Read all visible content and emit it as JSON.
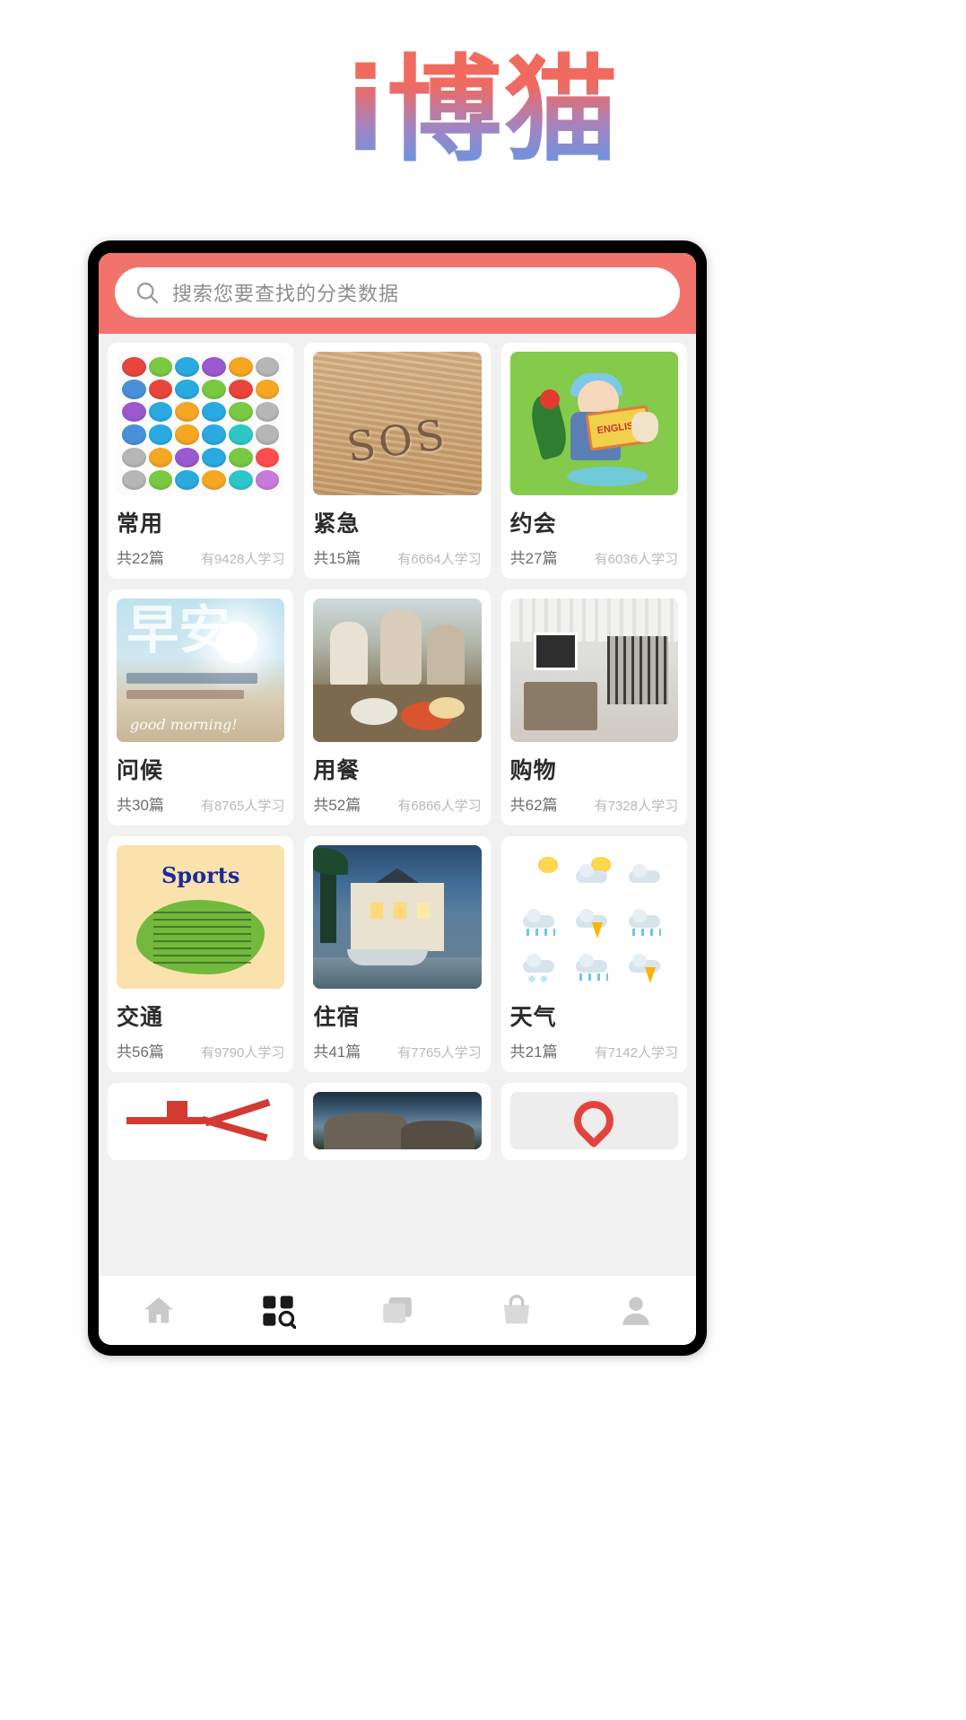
{
  "brand": {
    "title": "i博猫",
    "gradient_top": "#f26a5d",
    "gradient_bottom": "#6f93dd"
  },
  "phone": {
    "frame_color": "#000000",
    "screen_bg": "#f1f1f1"
  },
  "search": {
    "placeholder": "搜索您要查找的分类数据",
    "icon": "search-icon",
    "header_color": "#f2736c"
  },
  "categories": [
    {
      "title": "常用",
      "count": "共22篇",
      "learners": "有9428人学习",
      "art": "icon-grid"
    },
    {
      "title": "紧急",
      "count": "共15篇",
      "learners": "有6664人学习",
      "art": "desert-sos"
    },
    {
      "title": "约会",
      "count": "共27篇",
      "learners": "有6036人学习",
      "art": "green-english-girl"
    },
    {
      "title": "问候",
      "count": "共30篇",
      "learners": "有8765人学习",
      "art": "good-morning-sky"
    },
    {
      "title": "用餐",
      "count": "共52篇",
      "learners": "有6866人学习",
      "art": "dining-table"
    },
    {
      "title": "购物",
      "count": "共62篇",
      "learners": "有7328人学习",
      "art": "shop-interior"
    },
    {
      "title": "交通",
      "count": "共56篇",
      "learners": "有9790人学习",
      "art": "sports-poster"
    },
    {
      "title": "住宿",
      "count": "共41篇",
      "learners": "有7765人学习",
      "art": "hotel-night"
    },
    {
      "title": "天气",
      "count": "共21篇",
      "learners": "有7142人学习",
      "art": "weather-icons"
    },
    {
      "title": "",
      "count": "",
      "learners": "",
      "art": "red-arrows"
    },
    {
      "title": "",
      "count": "",
      "learners": "",
      "art": "landscape"
    },
    {
      "title": "",
      "count": "",
      "learners": "",
      "art": "location-pin"
    }
  ],
  "bottom_nav": [
    {
      "name": "home",
      "active": false
    },
    {
      "name": "category-search",
      "active": true
    },
    {
      "name": "layers",
      "active": false
    },
    {
      "name": "bag",
      "active": false
    },
    {
      "name": "profile",
      "active": false
    }
  ],
  "icon_grid_colors": [
    "#e8453c",
    "#7ac943",
    "#29abe2",
    "#9b59d0",
    "#f5a623",
    "#b6b6b6",
    "#4a90d9",
    "#e8453c",
    "#29abe2",
    "#7ac943",
    "#e8453c",
    "#f5a623",
    "#9b59d0",
    "#29abe2",
    "#f5a623",
    "#29abe2",
    "#7ac943",
    "#b6b6b6",
    "#4a90d9",
    "#29abe2",
    "#f5a623",
    "#29abe2",
    "#2ec7c7",
    "#b6b6b6",
    "#b6b6b6",
    "#f5a623",
    "#9b59d0",
    "#29abe2",
    "#7ac943",
    "#ff4d4d",
    "#b6b6b6",
    "#7ac943",
    "#29abe2",
    "#f5a623",
    "#2ec7c7",
    "#c77ad9"
  ]
}
